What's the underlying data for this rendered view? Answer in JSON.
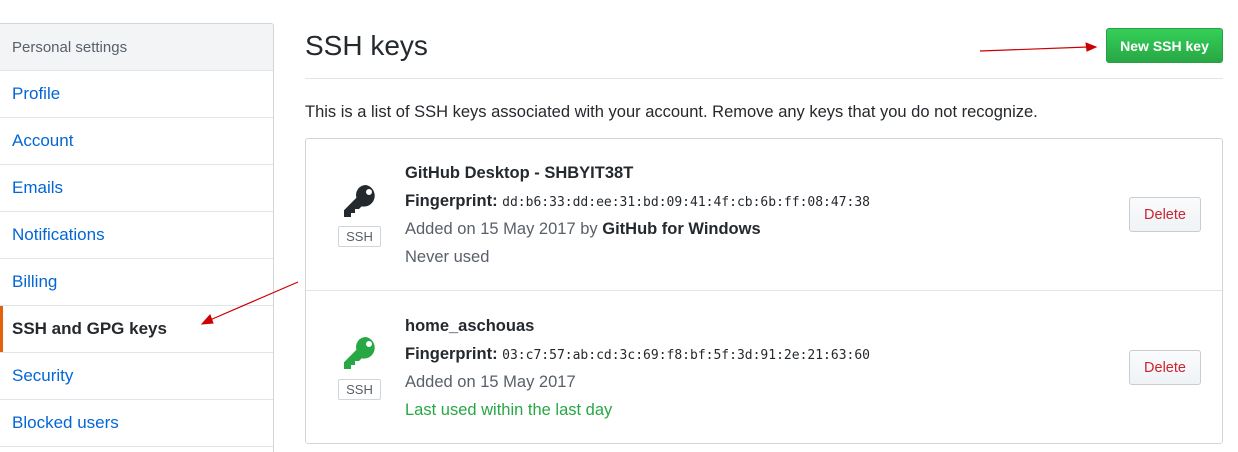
{
  "sidebar": {
    "header": "Personal settings",
    "items": [
      {
        "label": "Profile"
      },
      {
        "label": "Account"
      },
      {
        "label": "Emails"
      },
      {
        "label": "Notifications"
      },
      {
        "label": "Billing"
      },
      {
        "label": "SSH and GPG keys",
        "selected": true
      },
      {
        "label": "Security"
      },
      {
        "label": "Blocked users"
      }
    ]
  },
  "main": {
    "title": "SSH keys",
    "new_key_label": "New SSH key",
    "intro": "This is a list of SSH keys associated with your account. Remove any keys that you do not recognize.",
    "keys": [
      {
        "name": "GitHub Desktop - SHBYIT38T",
        "fingerprint_label": "Fingerprint:",
        "fingerprint": "dd:b6:33:dd:ee:31:bd:09:41:4f:cb:6b:ff:08:47:38",
        "added": "Added on 15 May 2017 by ",
        "added_by": "GitHub for Windows",
        "usage": "Never used",
        "badge": "SSH",
        "icon": "key-icon",
        "icon_color": "#24292e",
        "delete_label": "Delete"
      },
      {
        "name": "home_aschouas",
        "fingerprint_label": "Fingerprint:",
        "fingerprint": "03:c7:57:ab:cd:3c:69:f8:bf:5f:3d:91:2e:21:63:60",
        "added": "Added on 15 May 2017",
        "usage": "Last used within the last day",
        "badge": "SSH",
        "icon": "key-icon",
        "icon_color": "#28a745",
        "delete_label": "Delete"
      }
    ]
  },
  "colors": {
    "accent_green": "#28a745",
    "link_blue": "#0366d6",
    "delete_red": "#cb2431",
    "selected_marker": "#e36209",
    "annotation_arrow": "#cc0000"
  }
}
